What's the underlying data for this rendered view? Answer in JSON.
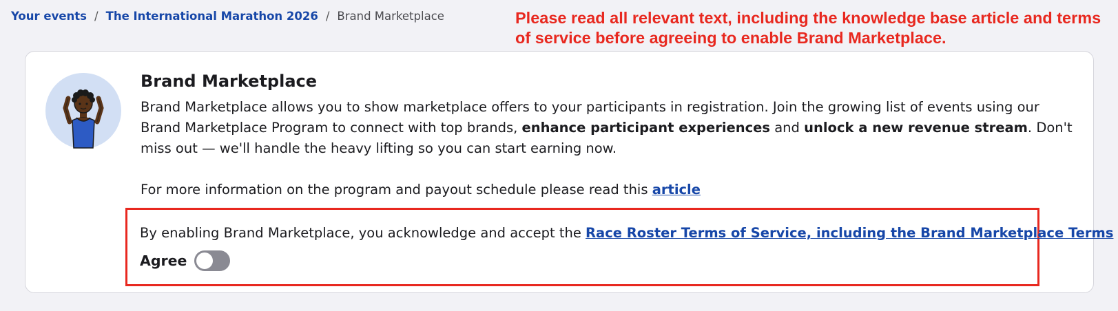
{
  "breadcrumb": {
    "items": [
      {
        "label": "Your events"
      },
      {
        "label": "The International Marathon 2026"
      }
    ],
    "separator": "/",
    "current": "Brand Marketplace"
  },
  "annotation": {
    "text": "Please read all relevant text, including the knowledge base article and terms of service before agreeing to enable Brand Marketplace.",
    "color": "#e8281f"
  },
  "card": {
    "title": "Brand Marketplace",
    "avatar_icon": "runner-illustration-icon",
    "description": {
      "part1": "Brand Marketplace allows you to show marketplace offers to your participants in registration. Join the growing list of events using our Brand Marketplace Program to connect with top brands, ",
      "bold1": "enhance participant experiences",
      "part2": " and ",
      "bold2": "unlock a new revenue stream",
      "part3": ". Don't miss out — we'll handle the heavy lifting so you can start earning now."
    },
    "info": {
      "text": "For more information on the program and payout schedule please read this ",
      "link_label": "article"
    },
    "terms": {
      "text": "By enabling Brand Marketplace, you acknowledge and accept the ",
      "link_label": "Race Roster Terms of Service, including the Brand Marketplace Terms"
    },
    "agree": {
      "label": "Agree",
      "enabled": false
    }
  },
  "colors": {
    "link": "#1747a8",
    "highlight": "#e8281f",
    "toggle_off": "#8a8a93",
    "page_bg": "#f2f2f6"
  }
}
